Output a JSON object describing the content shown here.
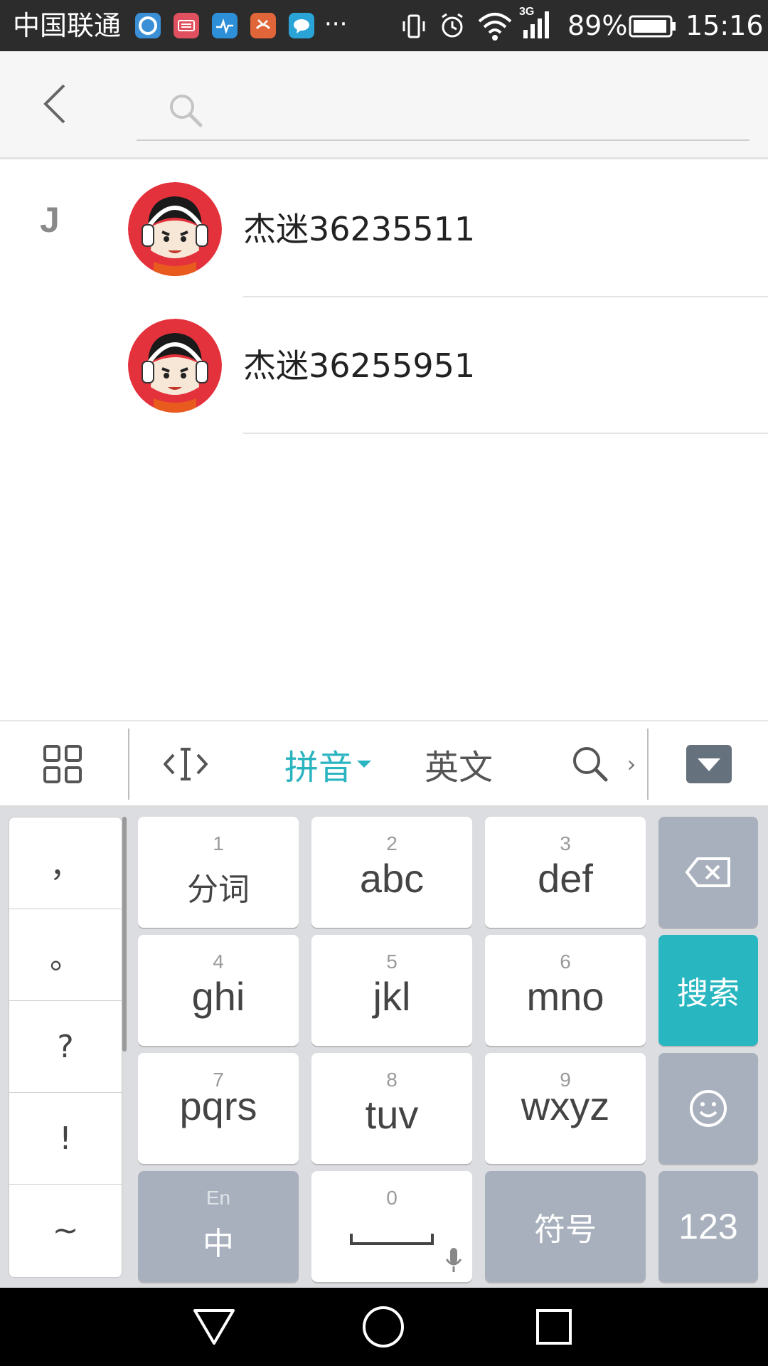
{
  "status_bar": {
    "carrier": "中国联通",
    "more": "···",
    "network": "3G",
    "battery": "89%",
    "time": "15:16"
  },
  "search": {
    "placeholder": ""
  },
  "contacts": {
    "section_letter": "J",
    "items": [
      {
        "name": "杰迷36235511"
      },
      {
        "name": "杰迷36255951"
      }
    ]
  },
  "ime_toolbar": {
    "pinyin": "拼音",
    "english": "英文",
    "more": "›"
  },
  "keyboard": {
    "punctuation": [
      "，",
      "。",
      "?",
      "!",
      "~"
    ],
    "keys": [
      {
        "num": "1",
        "label": "分词"
      },
      {
        "num": "2",
        "label": "abc"
      },
      {
        "num": "3",
        "label": "def"
      },
      {
        "num": "4",
        "label": "ghi"
      },
      {
        "num": "5",
        "label": "jkl"
      },
      {
        "num": "6",
        "label": "mno"
      },
      {
        "num": "7",
        "label": "pqrs"
      },
      {
        "num": "8",
        "label": "tuv"
      },
      {
        "num": "9",
        "label": "wxyz"
      }
    ],
    "search_key": "搜索",
    "lang_key_top": "En",
    "lang_key": "中",
    "space_num": "0",
    "symbol_key": "符号",
    "numeric_key": "123"
  },
  "colors": {
    "accent": "#2ab4c0",
    "keyboard_bg": "#dcdde0",
    "dark_key": "#a8b0bd"
  }
}
